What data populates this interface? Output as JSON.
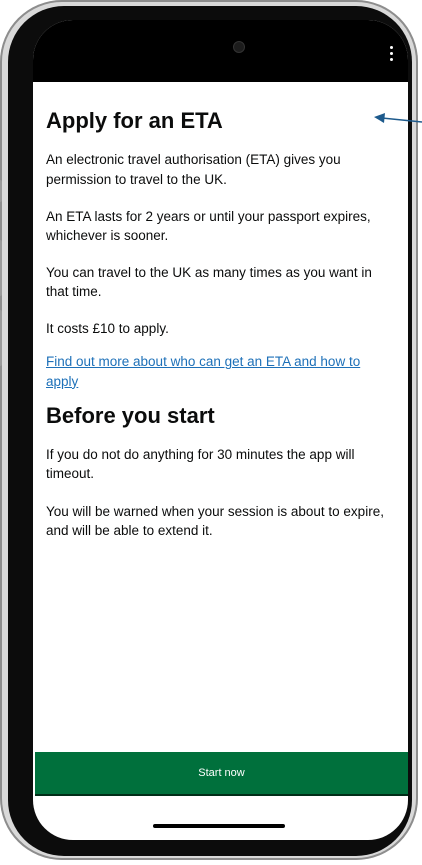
{
  "screen": {
    "title": "Apply for an ETA",
    "intro": "An electronic travel authorisation (ETA) gives you permission to travel to the UK.",
    "validity": "An ETA lasts for 2 years or until your passport expires, whichever is sooner.",
    "frequency": "You can travel to the UK as many times as you want in that time.",
    "cost": "It costs £10 to apply.",
    "more_link": "Find out more about who can get an ETA and how to apply",
    "section_title": "Before you start",
    "timeout": "If you do not do anything for 30 minutes the app will timeout.",
    "warning": "You will be warned when your session is about to expire, and will be able to extend it.",
    "start_button": "Start now"
  },
  "colors": {
    "primary_button": "#00703c",
    "link": "#1d70b8",
    "text": "#0b0c0c",
    "arrow": "#1d5a8c"
  },
  "icons": {
    "menu": "kebab-menu-icon",
    "camera": "front-camera-icon",
    "annotation": "arrow-left-icon"
  }
}
